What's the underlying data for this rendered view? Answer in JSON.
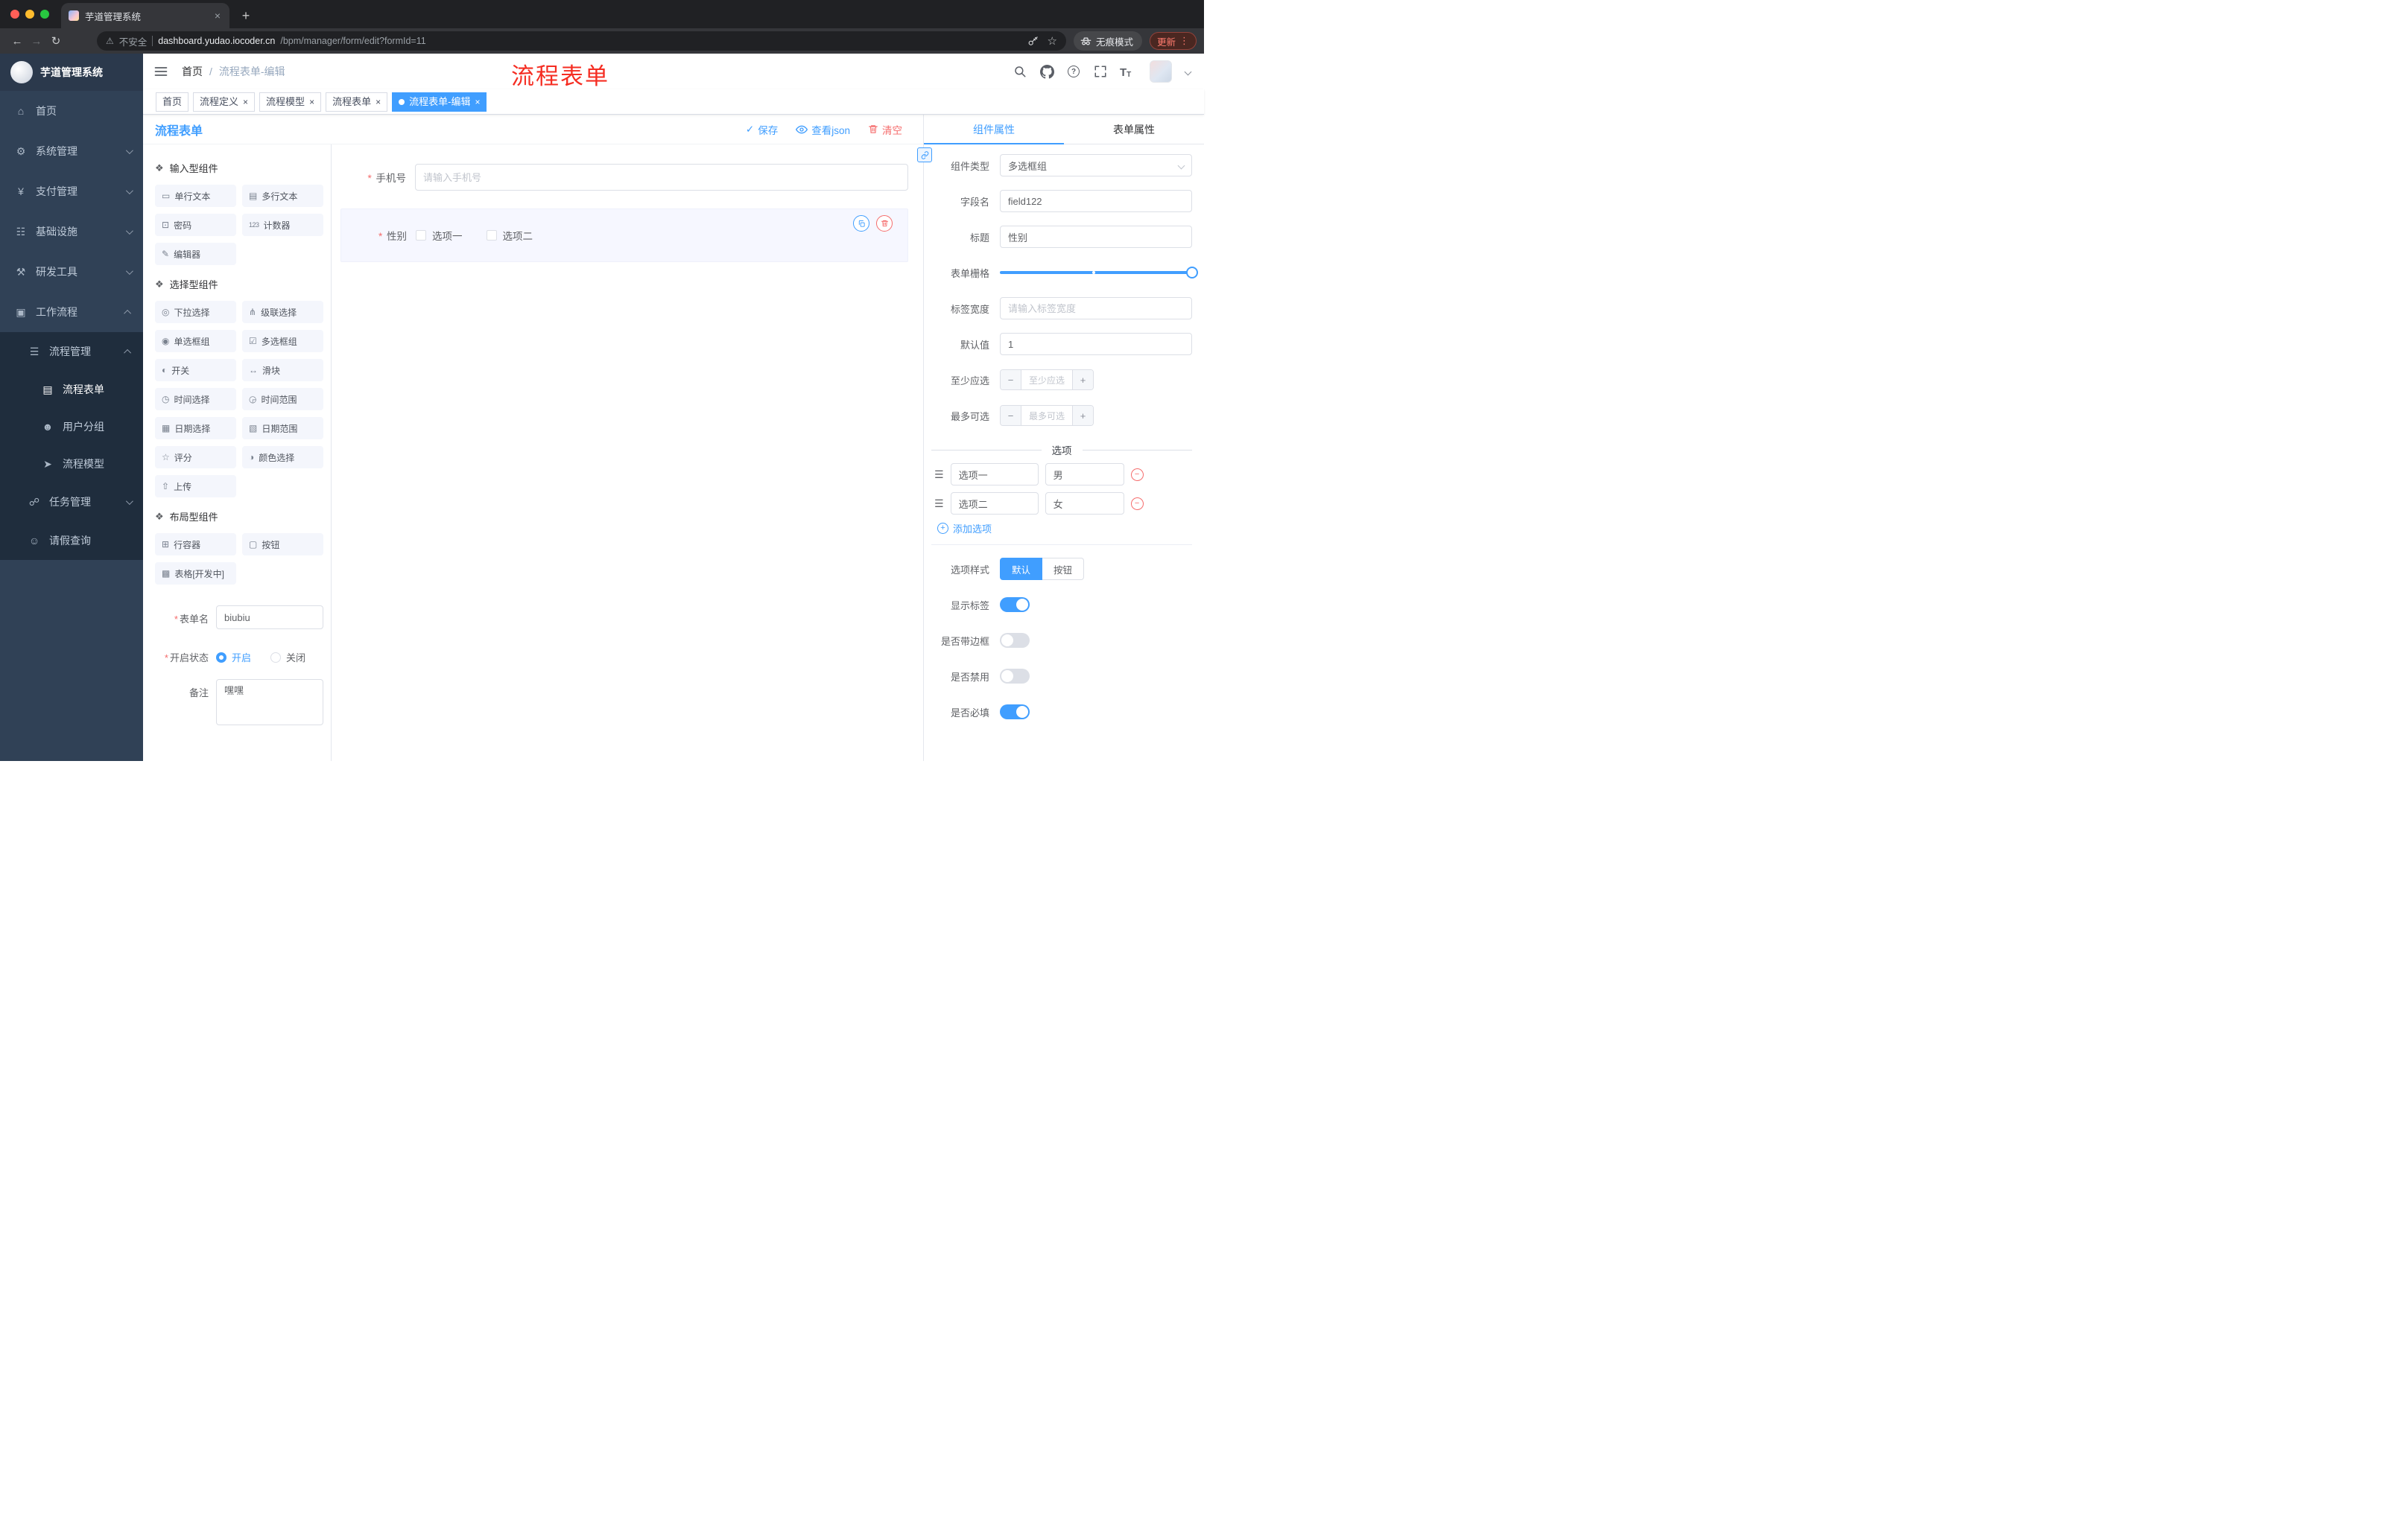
{
  "colors": {
    "accent": "#409eff",
    "danger": "#f56c6c",
    "annotation_red": "#f52d22",
    "sidebar_bg": "#304156"
  },
  "icons": {
    "close": "×",
    "new_tab": "+",
    "back": "←",
    "forward": "→",
    "reload": "↻",
    "warning": "⚠",
    "star": "☆",
    "dots": "⋮",
    "check": "✓",
    "minus": "−",
    "plus": "+",
    "question": "?",
    "letter_t": "T",
    "drag": "☰",
    "required": "*",
    "breadcrumb_sep": "/"
  },
  "browser": {
    "tab_title": "芋道管理系统",
    "security": "不安全",
    "url_domain": "dashboard.yudao.iocoder.cn",
    "url_path": "/bpm/manager/form/edit?formId=11",
    "incognito": "无痕模式",
    "update": "更新"
  },
  "sidebar": {
    "title": "芋道管理系统",
    "items": [
      {
        "label": "首页",
        "glyph": "⌂"
      },
      {
        "label": "系统管理",
        "glyph": "⚙"
      },
      {
        "label": "支付管理",
        "glyph": "¥"
      },
      {
        "label": "基础设施",
        "glyph": "☷"
      },
      {
        "label": "研发工具",
        "glyph": "⚒"
      },
      {
        "label": "工作流程",
        "glyph": "▣"
      }
    ],
    "workflow": {
      "process_mgmt": {
        "label": "流程管理",
        "glyph": "☰"
      },
      "process_children": [
        {
          "label": "流程表单",
          "glyph": "▤"
        },
        {
          "label": "用户分组",
          "glyph": "☻"
        },
        {
          "label": "流程模型",
          "glyph": "➤"
        }
      ],
      "task_mgmt": {
        "label": "任务管理",
        "glyph": "☍"
      },
      "leave_query": {
        "label": "请假查询",
        "glyph": "☺"
      }
    }
  },
  "header": {
    "breadcrumb_home": "首页",
    "breadcrumb_current": "流程表单-编辑",
    "annotation": "流程表单"
  },
  "tags": [
    {
      "label": "首页"
    },
    {
      "label": "流程定义"
    },
    {
      "label": "流程模型"
    },
    {
      "label": "流程表单"
    },
    {
      "label": "流程表单-编辑"
    }
  ],
  "designer": {
    "title": "流程表单",
    "actions": {
      "save": "保存",
      "view_json": "查看json",
      "clear": "清空"
    },
    "palette": {
      "groups": [
        {
          "title": "输入型组件",
          "glyph": "❖",
          "items": [
            {
              "label": "单行文本",
              "glyph": "▭"
            },
            {
              "label": "多行文本",
              "glyph": "▤"
            },
            {
              "label": "密码",
              "glyph": "⊡"
            },
            {
              "label": "计数器",
              "glyph": "123"
            },
            {
              "label": "编辑器",
              "glyph": "✎"
            }
          ]
        },
        {
          "title": "选择型组件",
          "glyph": "❖",
          "items": [
            {
              "label": "下拉选择",
              "glyph": "◎"
            },
            {
              "label": "级联选择",
              "glyph": "⋔"
            },
            {
              "label": "单选框组",
              "glyph": "◉"
            },
            {
              "label": "多选框组",
              "glyph": "☑"
            },
            {
              "label": "开关",
              "glyph": "◐"
            },
            {
              "label": "滑块",
              "glyph": "↔"
            },
            {
              "label": "时间选择",
              "glyph": "◷"
            },
            {
              "label": "时间范围",
              "glyph": "◶"
            },
            {
              "label": "日期选择",
              "glyph": "▦"
            },
            {
              "label": "日期范围",
              "glyph": "▧"
            },
            {
              "label": "评分",
              "glyph": "☆"
            },
            {
              "label": "颜色选择",
              "glyph": "◑"
            },
            {
              "label": "上传",
              "glyph": "⇧"
            }
          ]
        },
        {
          "title": "布局型组件",
          "glyph": "❖",
          "items": [
            {
              "label": "行容器",
              "glyph": "⊞"
            },
            {
              "label": "按钮",
              "glyph": "▢"
            },
            {
              "label": "表格[开发中]",
              "glyph": "▩"
            }
          ]
        }
      ]
    },
    "meta": {
      "name": {
        "label": "表单名",
        "value": "biubiu"
      },
      "status": {
        "label": "开启状态",
        "selected": "开启",
        "options": [
          {
            "label": "开启"
          },
          {
            "label": "关闭"
          }
        ]
      },
      "remark": {
        "label": "备注",
        "value": "嘿嘿"
      }
    },
    "canvas": {
      "phone": {
        "label": "手机号",
        "placeholder": "请输入手机号"
      },
      "gender": {
        "label": "性别",
        "options": [
          {
            "label": "选项一"
          },
          {
            "label": "选项二"
          }
        ]
      }
    }
  },
  "props": {
    "tabs": [
      {
        "label": "组件属性"
      },
      {
        "label": "表单属性"
      }
    ],
    "active_tab": "组件属性",
    "rows": {
      "component_type": {
        "label": "组件类型",
        "value": "多选框组"
      },
      "field_name": {
        "label": "字段名",
        "value": "field122"
      },
      "title": {
        "label": "标题",
        "value": "性别"
      },
      "grid": {
        "label": "表单栅格"
      },
      "label_width": {
        "label": "标签宽度",
        "placeholder": "请输入标签宽度"
      },
      "default": {
        "label": "默认值",
        "value": "1"
      },
      "min_select": {
        "label": "至少应选",
        "placeholder": "至少应选"
      },
      "max_select": {
        "label": "最多可选",
        "placeholder": "最多可选"
      }
    },
    "options": {
      "divider": "选项",
      "rows": [
        {
          "name": "选项一",
          "value": "男"
        },
        {
          "name": "选项二",
          "value": "女"
        }
      ],
      "add": "添加选项"
    },
    "style": {
      "label": "选项样式",
      "buttons": [
        {
          "label": "默认",
          "active": true
        },
        {
          "label": "按钮",
          "active": false
        }
      ],
      "toggles": [
        {
          "label": "显示标签",
          "on": true
        },
        {
          "label": "是否带边框",
          "on": false
        },
        {
          "label": "是否禁用",
          "on": false
        },
        {
          "label": "是否必填",
          "on": true
        }
      ]
    }
  }
}
